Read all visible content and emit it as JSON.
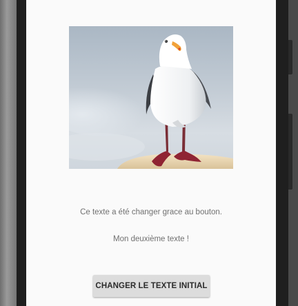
{
  "image": {
    "subject": "seagull standing on a buoy",
    "icon": "seagull-photo"
  },
  "texts": {
    "line1": "Ce texte a été changer grace au bouton.",
    "line2": "Mon deuxième texte !"
  },
  "button": {
    "label": "CHANGER LE TEXTE INITIAL"
  },
  "colors": {
    "screen_background": "#fafafa",
    "button_background": "#dcdcdc",
    "body_text": "#707070"
  }
}
